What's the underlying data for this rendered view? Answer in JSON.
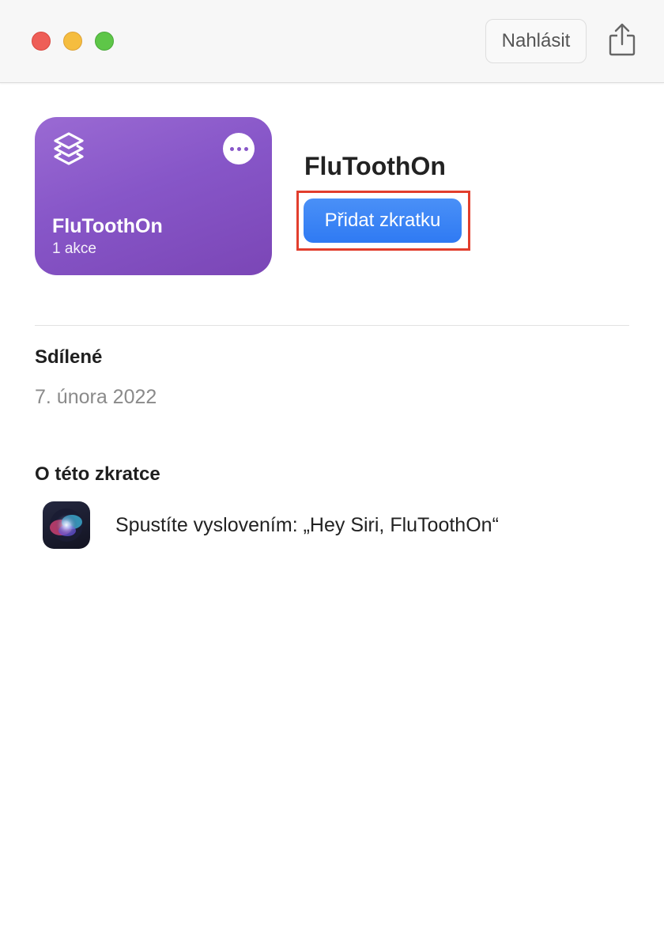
{
  "window": {
    "report_label": "Nahlásit"
  },
  "shortcut_card": {
    "title": "FluToothOn",
    "subtitle": "1 akce",
    "gradient_top": "#9a6ad3",
    "gradient_bottom": "#7b46b6"
  },
  "main": {
    "title": "FluToothOn",
    "add_button_label": "Přidat zkratku",
    "highlight_color": "#e23e2d",
    "accent": "#2f7af3"
  },
  "shared": {
    "heading": "Sdílené",
    "date": "7. února 2022"
  },
  "about": {
    "heading": "O této zkratce",
    "siri_phrase": "Spustíte vyslovením: „Hey Siri, FluToothOn“",
    "icon": "siri-icon"
  }
}
